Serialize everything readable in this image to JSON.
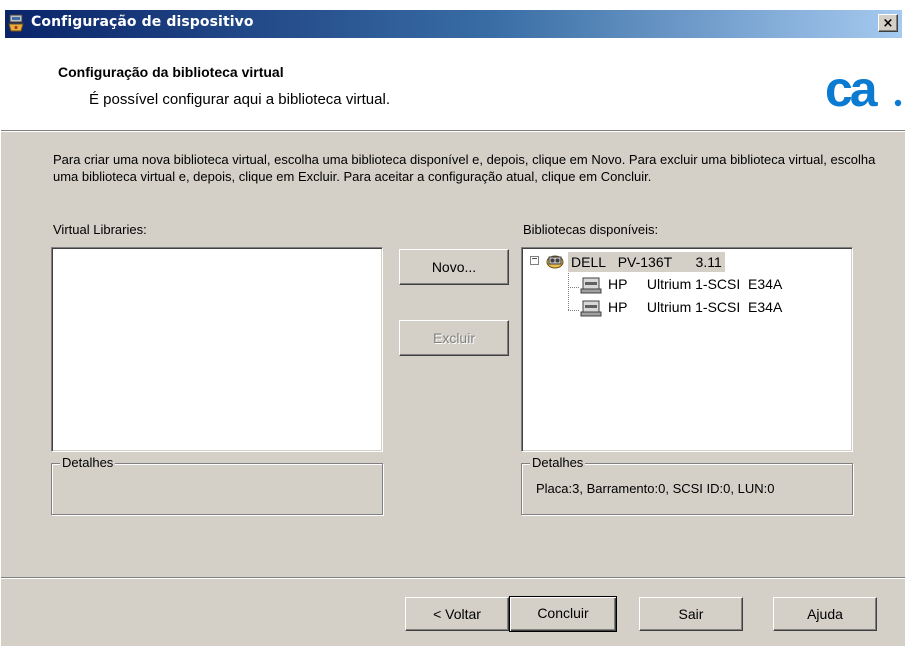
{
  "window": {
    "title": "Configuração de dispositivo",
    "close_label": "×"
  },
  "header": {
    "title": "Configuração da biblioteca virtual",
    "subtitle": "É possível configurar aqui a biblioteca virtual.",
    "logo_text": "ca."
  },
  "intro_text": "Para criar uma nova biblioteca virtual, escolha uma biblioteca disponível e, depois, clique em Novo. Para excluir uma biblioteca virtual, escolha uma biblioteca virtual e, depois, clique em Excluir. Para aceitar a configuração atual, clique em Concluir.",
  "virtual_libraries": {
    "label": "Virtual Libraries:",
    "items": [],
    "details_label": "Detalhes",
    "details_value": ""
  },
  "actions": {
    "new_label": "Novo...",
    "delete_label": "Excluir",
    "delete_enabled": false
  },
  "available_libraries": {
    "label": "Bibliotecas disponíveis:",
    "tree": {
      "expander": "−",
      "root": {
        "vendor": "DELL",
        "model": "PV-136T",
        "revision": "3.11",
        "icon": "tape-library-icon",
        "selected": true
      },
      "children": [
        {
          "vendor": "HP",
          "model": "Ultrium 1-SCSI",
          "revision": "E34A",
          "icon": "tape-drive-icon"
        },
        {
          "vendor": "HP",
          "model": "Ultrium 1-SCSI",
          "revision": "E34A",
          "icon": "tape-drive-icon"
        }
      ]
    },
    "details_label": "Detalhes",
    "details_value": "Placa:3, Barramento:0, SCSI ID:0, LUN:0"
  },
  "footer": {
    "back_label": "< Voltar",
    "finish_label": "Concluir",
    "exit_label": "Sair",
    "help_label": "Ajuda"
  },
  "colors": {
    "titlebar_start": "#0a246a",
    "titlebar_end": "#a6caf0",
    "dialog_face": "#d4d0c8",
    "logo_blue": "#0a7bd0",
    "selection": "#d4d0c8"
  }
}
